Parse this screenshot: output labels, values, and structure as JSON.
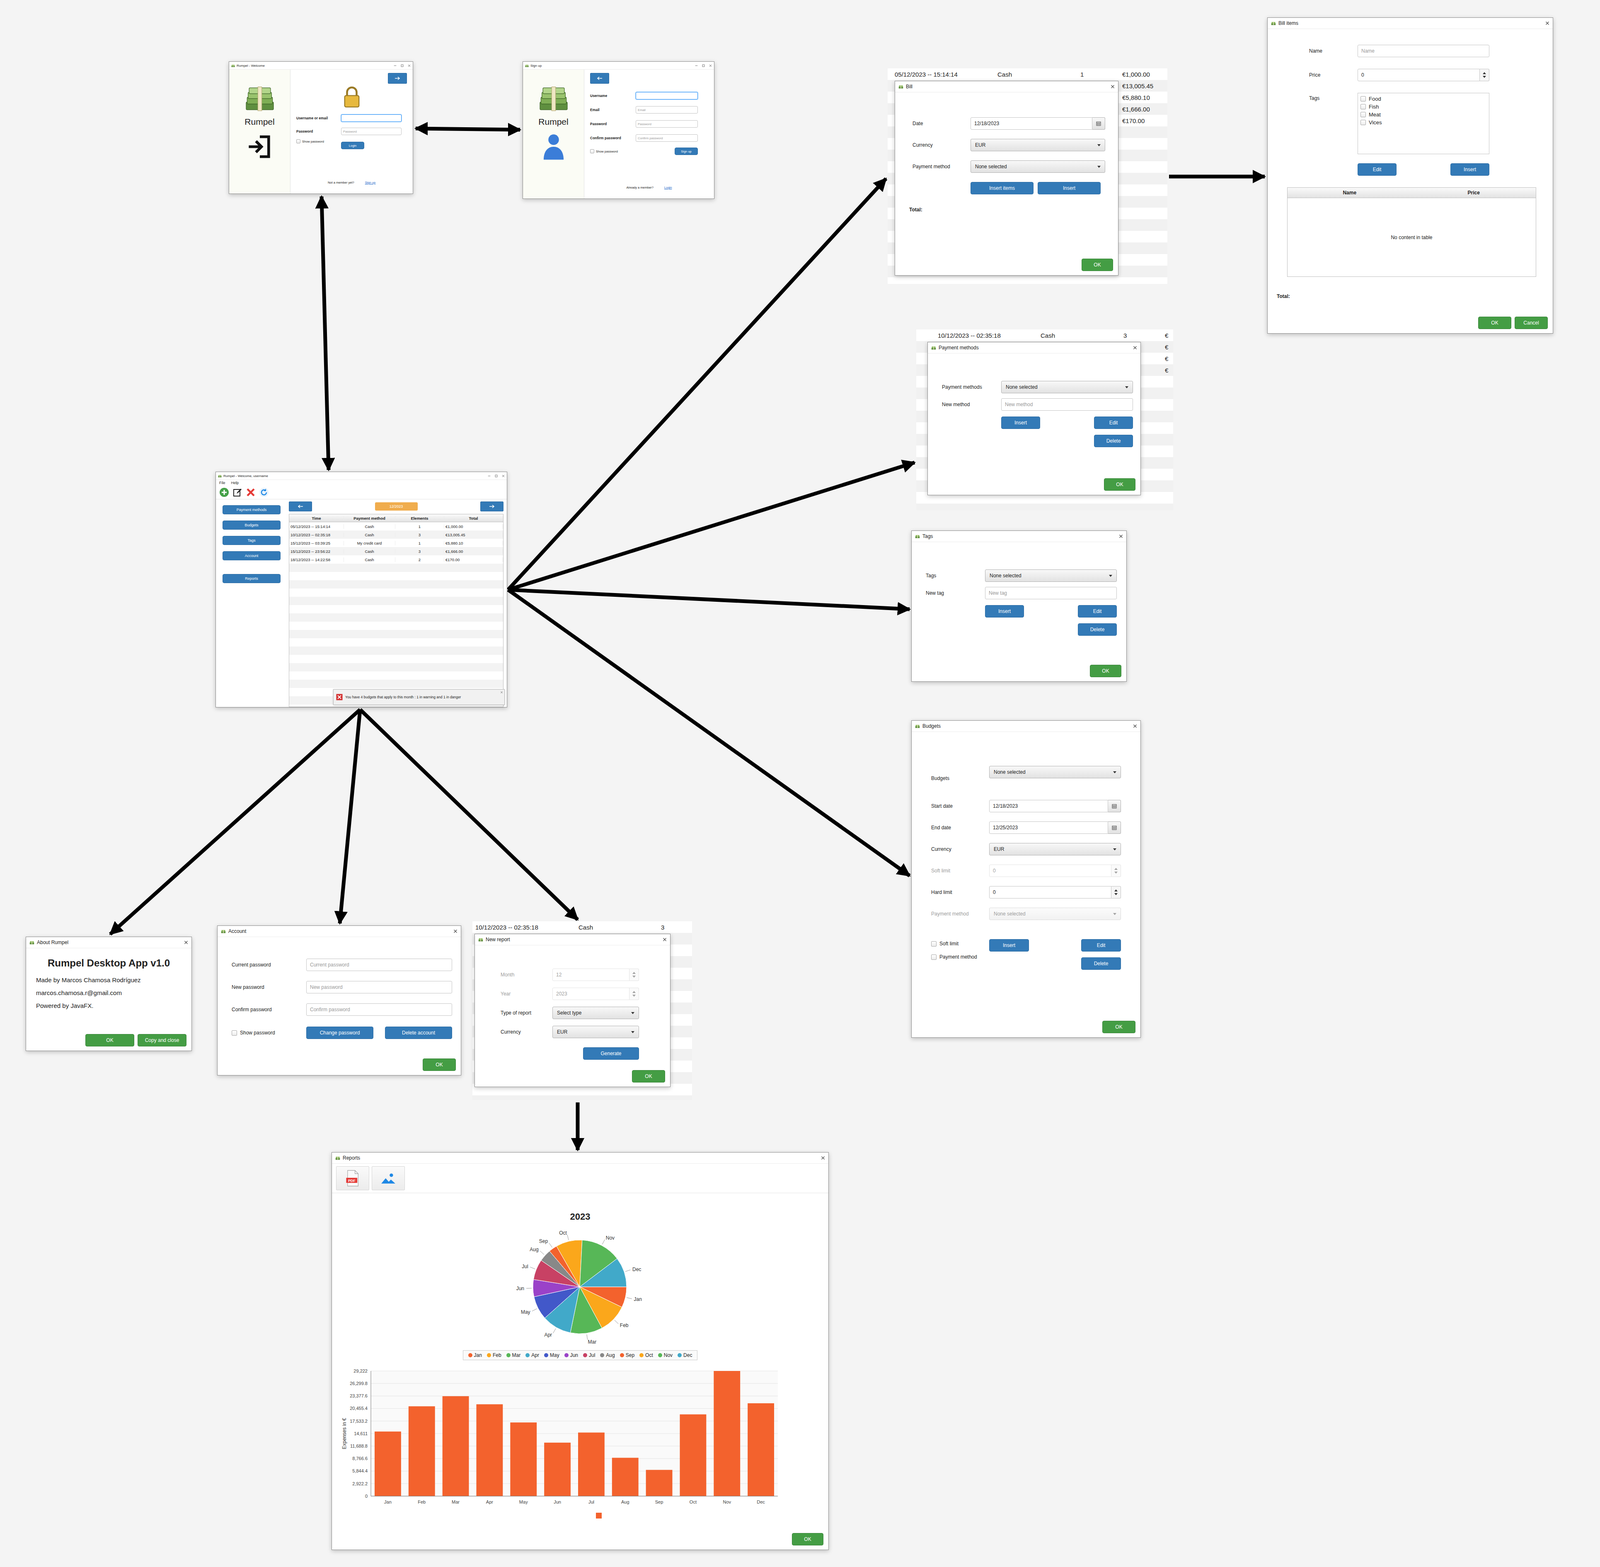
{
  "connections": [
    {
      "from": "login",
      "to": "signup",
      "bidirectional": true
    },
    {
      "from": "login",
      "to": "main",
      "bidirectional": true
    },
    {
      "from": "main",
      "to": "bill",
      "bidirectional": false
    },
    {
      "from": "main",
      "to": "payment_methods",
      "bidirectional": false
    },
    {
      "from": "main",
      "to": "tags",
      "bidirectional": false
    },
    {
      "from": "main",
      "to": "budgets",
      "bidirectional": false
    },
    {
      "from": "bill",
      "to": "bill_items",
      "bidirectional": false
    },
    {
      "from": "main",
      "to": "about",
      "bidirectional": false
    },
    {
      "from": "main",
      "to": "account",
      "bidirectional": false
    },
    {
      "from": "main",
      "to": "new_report",
      "bidirectional": false
    },
    {
      "from": "new_report",
      "to": "reports",
      "bidirectional": false
    }
  ],
  "login": {
    "title": "Rumpel - Welcome",
    "app_name": "Rumpel",
    "fields": [
      {
        "label": "Username or email",
        "placeholder": "",
        "value": "",
        "kind": "text",
        "focused": true,
        "disabled": false
      },
      {
        "label": "Password",
        "placeholder": "Password",
        "value": "",
        "kind": "text",
        "focused": false,
        "disabled": false
      }
    ],
    "show_password": {
      "label": "Show password",
      "checked": false
    },
    "submit": "Login",
    "prompt": "Not a member yet?",
    "link": "Sign up"
  },
  "signup": {
    "title": "Sign up",
    "app_name": "Rumpel",
    "fields": [
      {
        "label": "Username",
        "placeholder": "",
        "value": "",
        "kind": "text",
        "focused": true,
        "disabled": false
      },
      {
        "label": "Email",
        "placeholder": "Email",
        "value": "",
        "kind": "text",
        "focused": false,
        "disabled": false
      },
      {
        "label": "Password",
        "placeholder": "Password",
        "value": "",
        "kind": "text",
        "focused": false,
        "disabled": false
      },
      {
        "label": "Confirm password",
        "placeholder": "Confirm password",
        "value": "",
        "kind": "text",
        "focused": false,
        "disabled": false
      }
    ],
    "show_password": {
      "label": "Show password",
      "checked": false
    },
    "submit": "Sign up",
    "prompt": "Already a member?",
    "link": "Login"
  },
  "main": {
    "title": "Rumpel - Welcome, username",
    "menu": [
      "File",
      "Help"
    ],
    "sidebar": [
      "Payment methods",
      "Budgets",
      "Tags",
      "Account"
    ],
    "reports_button": "Reports",
    "month": "12/2023",
    "table": {
      "columns": [
        "Time",
        "Payment method",
        "Elements",
        "Total"
      ],
      "rows": [
        [
          "05/12/2023 -- 15:14:14",
          "Cash",
          "1",
          "€1,000.00"
        ],
        [
          "10/12/2023 -- 02:35:18",
          "Cash",
          "3",
          "€13,005.45"
        ],
        [
          "15/12/2023 -- 03:39:25",
          "My credit card",
          "1",
          "€5,880.10"
        ],
        [
          "15/12/2023 -- 23:56:22",
          "Cash",
          "3",
          "€1,666.00"
        ],
        [
          "18/12/2023 -- 14:22:58",
          "Cash",
          "2",
          "€170.00"
        ]
      ]
    },
    "notification": "You have 4 budgets that apply to this month : 1 in warning and 1 in danger"
  },
  "bill": {
    "background_row": [
      "05/12/2023 -- 15:14:14",
      "Cash",
      "1"
    ],
    "background_totals": [
      "€1,000.00",
      "€13,005.45",
      "€5,880.10",
      "€1,666.00",
      "€170.00"
    ],
    "title": "Bill",
    "fields": [
      {
        "label": "Date",
        "value": "12/18/2023",
        "kind": "date",
        "disabled": false
      },
      {
        "label": "Currency",
        "value": "EUR",
        "kind": "select",
        "disabled": false
      },
      {
        "label": "Payment method",
        "value": "None selected",
        "kind": "select",
        "disabled": false
      }
    ],
    "buttons": [
      "Insert items",
      "Insert"
    ],
    "total_label": "Total:",
    "ok": "OK"
  },
  "bill_items": {
    "title": "Bill items",
    "fields": [
      {
        "label": "Name",
        "placeholder": "Name",
        "value": "",
        "kind": "text",
        "focused": false,
        "disabled": false
      },
      {
        "label": "Price",
        "value": "0",
        "kind": "spinner",
        "disabled": false
      }
    ],
    "tags_label": "Tags",
    "tags": [
      {
        "label": "Food",
        "checked": false
      },
      {
        "label": "Fish",
        "checked": false
      },
      {
        "label": "Meat",
        "checked": false
      },
      {
        "label": "Vices",
        "checked": false
      }
    ],
    "buttons": [
      "Edit",
      "Insert"
    ],
    "table": {
      "columns": [
        "Name",
        "Price"
      ],
      "empty": "No content in table"
    },
    "total_label": "Total:",
    "ok": "OK",
    "cancel": "Cancel"
  },
  "payment_methods": {
    "background_row": [
      "10/12/2023 -- 02:35:18",
      "Cash",
      "3"
    ],
    "background_totals": [
      "€",
      "€",
      "€",
      "€"
    ],
    "title": "Payment methods",
    "fields": [
      {
        "label": "Payment methods",
        "value": "None selected",
        "kind": "select",
        "disabled": false
      },
      {
        "label": "New method",
        "placeholder": "New method",
        "value": "",
        "kind": "text",
        "focused": false,
        "disabled": false
      }
    ],
    "insert": "Insert",
    "edit": "Edit",
    "delete": "Delete",
    "ok": "OK"
  },
  "tags": {
    "title": "Tags",
    "fields": [
      {
        "label": "Tags",
        "value": "None selected",
        "kind": "select",
        "disabled": false
      },
      {
        "label": "New tag",
        "placeholder": "New tag",
        "value": "",
        "kind": "text",
        "focused": false,
        "disabled": false
      }
    ],
    "insert": "Insert",
    "edit": "Edit",
    "delete": "Delete",
    "ok": "OK"
  },
  "budgets": {
    "title": "Budgets",
    "fields": [
      {
        "label": "Budgets",
        "value": "None selected",
        "kind": "select",
        "disabled": false
      },
      {
        "label": "Start date",
        "value": "12/18/2023",
        "kind": "date",
        "disabled": false
      },
      {
        "label": "End date",
        "value": "12/25/2023",
        "kind": "date",
        "disabled": false
      },
      {
        "label": "Currency",
        "value": "EUR",
        "kind": "select",
        "disabled": false
      },
      {
        "label": "Soft limit",
        "value": "0",
        "kind": "spinner",
        "disabled": true
      },
      {
        "label": "Hard limit",
        "value": "0",
        "kind": "spinner",
        "disabled": false
      },
      {
        "label": "Payment method",
        "value": "None selected",
        "kind": "select",
        "disabled": true
      }
    ],
    "checkboxes": [
      {
        "label": "Soft limit",
        "checked": false
      },
      {
        "label": "Payment method",
        "checked": false
      }
    ],
    "insert": "Insert",
    "edit": "Edit",
    "delete": "Delete",
    "ok": "OK"
  },
  "about": {
    "title": "About Rumpel",
    "heading": "Rumpel Desktop App v1.0",
    "lines": [
      "Made by Marcos Chamosa Rodríguez",
      "marcos.chamosa.r@gmail.com",
      "Powered by JavaFX."
    ],
    "buttons": [
      "OK",
      "Copy and close"
    ]
  },
  "account": {
    "title": "Account",
    "fields": [
      {
        "label": "Current password",
        "placeholder": "Current password",
        "value": "",
        "kind": "text",
        "focused": false,
        "disabled": false
      },
      {
        "label": "New password",
        "placeholder": "New password",
        "value": "",
        "kind": "text",
        "focused": false,
        "disabled": false
      },
      {
        "label": "Confirm password",
        "placeholder": "Confirm password",
        "value": "",
        "kind": "text",
        "focused": false,
        "disabled": false
      }
    ],
    "show_password": {
      "label": "Show password",
      "checked": false
    },
    "buttons": [
      "Change password",
      "Delete account"
    ],
    "ok": "OK"
  },
  "new_report": {
    "background_row": [
      "10/12/2023 -- 02:35:18",
      "Cash",
      "3"
    ],
    "background_totals": [],
    "title": "New report",
    "fields": [
      {
        "label": "Month",
        "value": "12",
        "kind": "spinner",
        "disabled": true
      },
      {
        "label": "Year",
        "value": "2023",
        "kind": "spinner",
        "disabled": true
      },
      {
        "label": "Type of report",
        "value": "Select type",
        "kind": "select",
        "disabled": false
      },
      {
        "label": "Currency",
        "value": "EUR",
        "kind": "select",
        "disabled": false
      }
    ],
    "generate": "Generate",
    "ok": "OK"
  },
  "reports": {
    "title": "Reports",
    "pdf_icon_label": "PDF",
    "chart_title": "2023",
    "pie": {
      "slices": [
        {
          "label": "Jan",
          "value": 15083,
          "color": "#f3622d"
        },
        {
          "label": "Feb",
          "value": 20974,
          "color": "#fba71b"
        },
        {
          "label": "Mar",
          "value": 23331,
          "color": "#57b757"
        },
        {
          "label": "Apr",
          "value": 21445,
          "color": "#41a9c9"
        },
        {
          "label": "May",
          "value": 17203,
          "color": "#4258c9"
        },
        {
          "label": "Jun",
          "value": 12490,
          "color": "#9a42c8"
        },
        {
          "label": "Jul",
          "value": 14847,
          "color": "#c84164"
        },
        {
          "label": "Aug",
          "value": 8955,
          "color": "#888888"
        },
        {
          "label": "Sep",
          "value": 6127,
          "color": "#f3622d"
        },
        {
          "label": "Oct",
          "value": 19089,
          "color": "#fba71b"
        },
        {
          "label": "Nov",
          "value": 29222,
          "color": "#57b757"
        },
        {
          "label": "Dec",
          "value": 21681,
          "color": "#41a9c9"
        }
      ]
    },
    "bar": {
      "series": [
        {
          "values": [
            15083,
            20974,
            23331,
            21445,
            17203,
            12490,
            14847,
            8955,
            6127,
            19089,
            29222,
            21681
          ],
          "color": "#f3622d"
        }
      ],
      "x_labels": [
        "Jan",
        "Feb",
        "Mar",
        "Apr",
        "May",
        "Jun",
        "Jul",
        "Aug",
        "Sep",
        "Oct",
        "Nov",
        "Dec"
      ],
      "y_ticks": [
        "29,222",
        "26,299.8",
        "23,377.6",
        "20,455.4",
        "17,533.2",
        "14,611",
        "11,688.8",
        "8,766.6",
        "5,844.4",
        "2,922.2",
        "0"
      ],
      "y_axis_label": "Expenses in €"
    },
    "ok": "OK"
  }
}
